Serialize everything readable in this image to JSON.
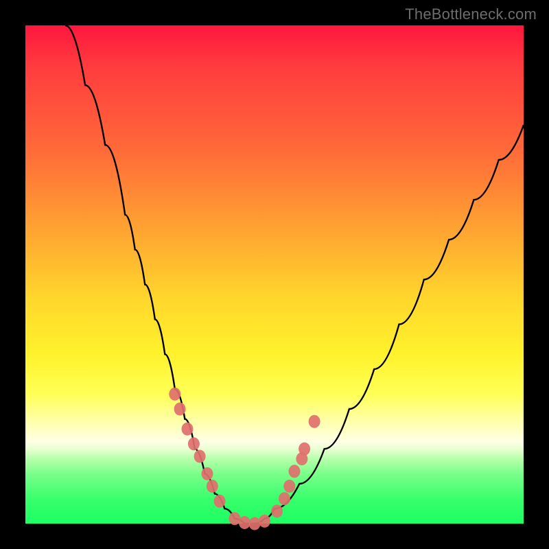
{
  "watermark": "TheBottleneck.com",
  "colors": {
    "background": "#000000",
    "curve": "#000000",
    "marker": "#e0706d"
  },
  "chart_data": {
    "type": "line",
    "title": "",
    "xlabel": "",
    "ylabel": "",
    "xlim": [
      0,
      100
    ],
    "ylim": [
      0,
      100
    ],
    "grid": false,
    "legend": false,
    "series": [
      {
        "name": "curve",
        "x": [
          8,
          12,
          16,
          20,
          22,
          24,
          26,
          28,
          30,
          32,
          34,
          36,
          38,
          40,
          42,
          44,
          46,
          48,
          50,
          55,
          60,
          65,
          70,
          75,
          80,
          85,
          90,
          95,
          100
        ],
        "y": [
          100,
          88,
          76,
          62,
          55,
          48,
          41,
          34,
          27,
          21,
          15,
          10,
          6,
          3,
          1,
          0,
          0,
          1,
          3,
          8,
          15,
          23,
          31,
          40,
          49,
          57,
          65,
          73,
          80
        ]
      }
    ],
    "markers": {
      "name": "highlighted-points",
      "x": [
        30.0,
        31.0,
        32.5,
        33.8,
        35.0,
        36.5,
        37.5,
        39.0,
        42.0,
        44.0,
        46.0,
        48.0,
        50.5,
        52.0,
        53.0,
        54.0,
        55.5,
        56.0,
        58.0
      ],
      "y": [
        26.0,
        23.0,
        19.0,
        16.0,
        13.5,
        10.0,
        7.5,
        4.5,
        1.0,
        0.2,
        0.0,
        0.5,
        2.5,
        5.0,
        7.5,
        10.5,
        13.0,
        15.0,
        20.5
      ]
    }
  }
}
